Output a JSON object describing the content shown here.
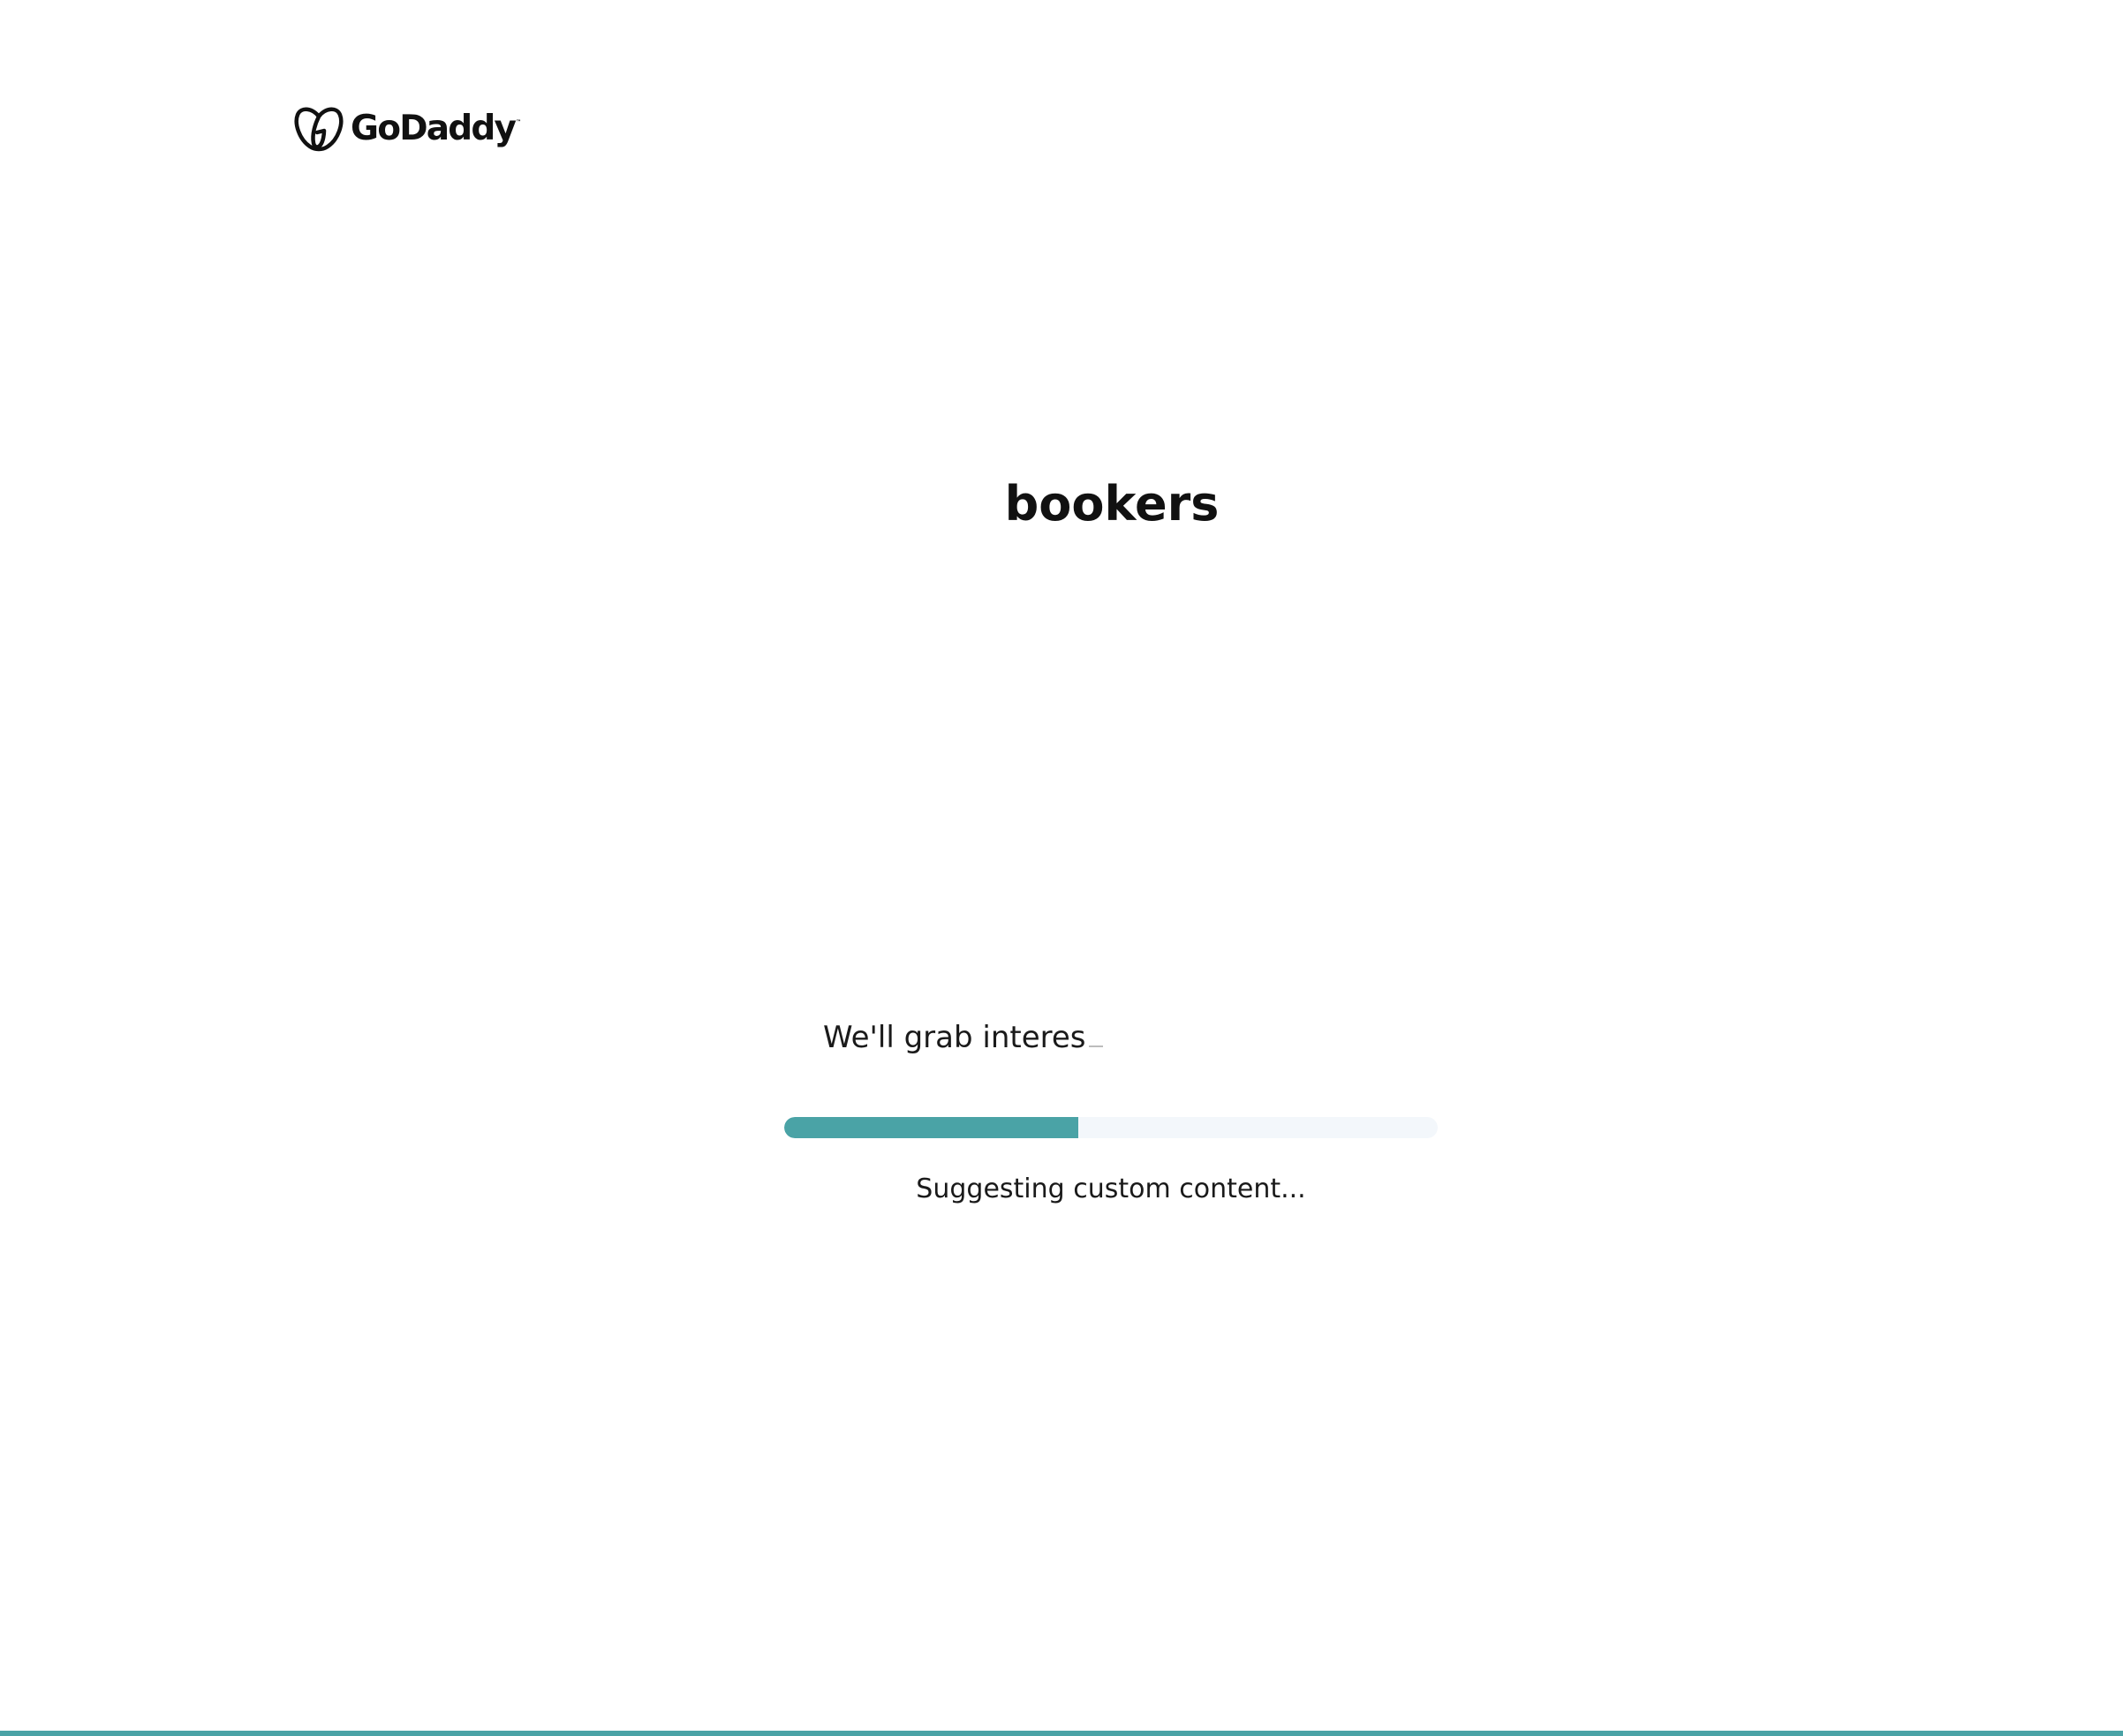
{
  "brand": {
    "logo_name": "godaddy-logo",
    "logo_text": "GoDaddy",
    "trademark": "™"
  },
  "site": {
    "name": "bookers"
  },
  "loading": {
    "typing_text": "We'll grab interes",
    "progress_fraction": 0.45,
    "status_text": "Suggesting custom content...",
    "accent_color": "#4aa3a6",
    "track_color": "#f3f7fb"
  }
}
